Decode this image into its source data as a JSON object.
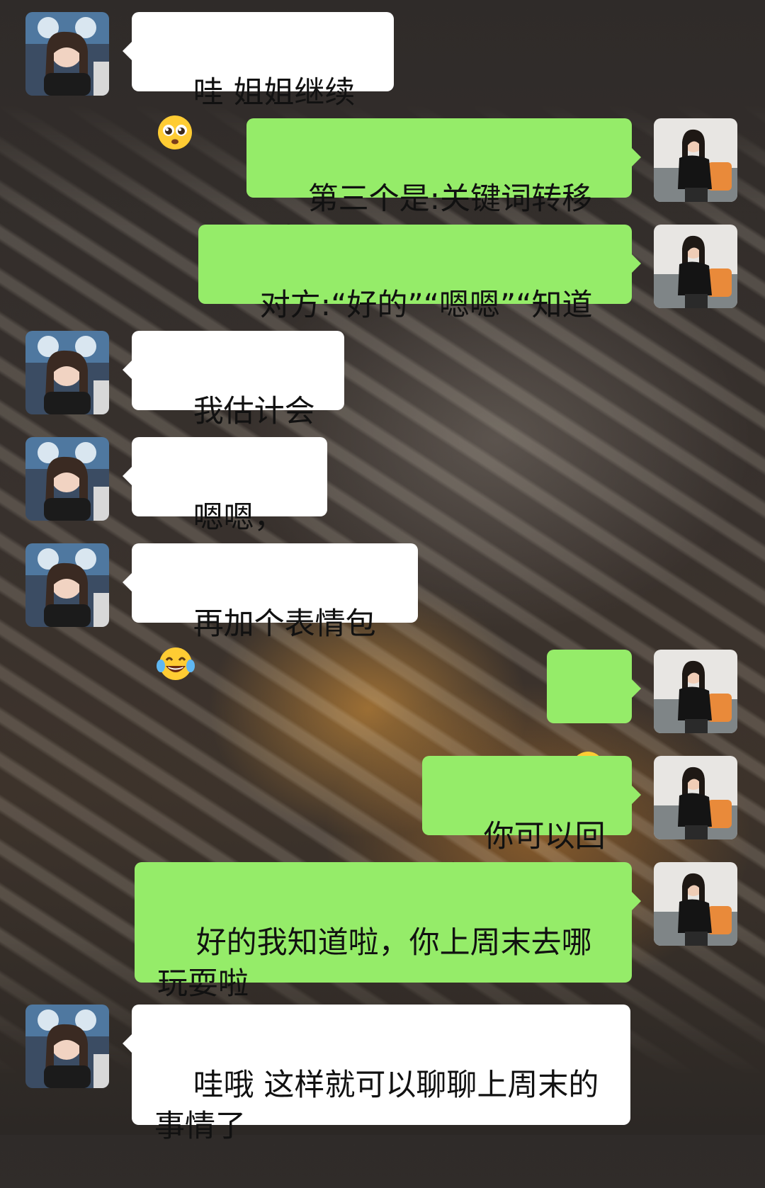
{
  "messages": [
    {
      "side": "left",
      "text": "哇 姐姐继续",
      "emoji": "pleading-face-icon"
    },
    {
      "side": "right",
      "text": "第三个是:关键词转移法"
    },
    {
      "side": "right",
      "text": "对方:“好的”“嗯嗯”“知道了”"
    },
    {
      "side": "left",
      "text": "我估计会回"
    },
    {
      "side": "left",
      "text": "嗯嗯，OK"
    },
    {
      "side": "left",
      "text": "再加个表情包",
      "emoji": "tears-of-joy-face-icon"
    },
    {
      "side": "right",
      "text": "",
      "emoji": "hand-over-mouth-face-icon"
    },
    {
      "side": "right",
      "text": "你可以回复"
    },
    {
      "side": "right",
      "text": "好的我知道啦，你上周末去哪\n玩耍啦"
    },
    {
      "side": "left",
      "text": "哇哦 这样就可以聊聊上周末的\n事情了"
    }
  ],
  "colors": {
    "left_bubble": "#ffffff",
    "right_bubble": "#95ec69",
    "text": "#111111"
  },
  "avatars": {
    "left": "avatar-girl-with-ear-headband",
    "right": "avatar-woman-on-sofa"
  }
}
